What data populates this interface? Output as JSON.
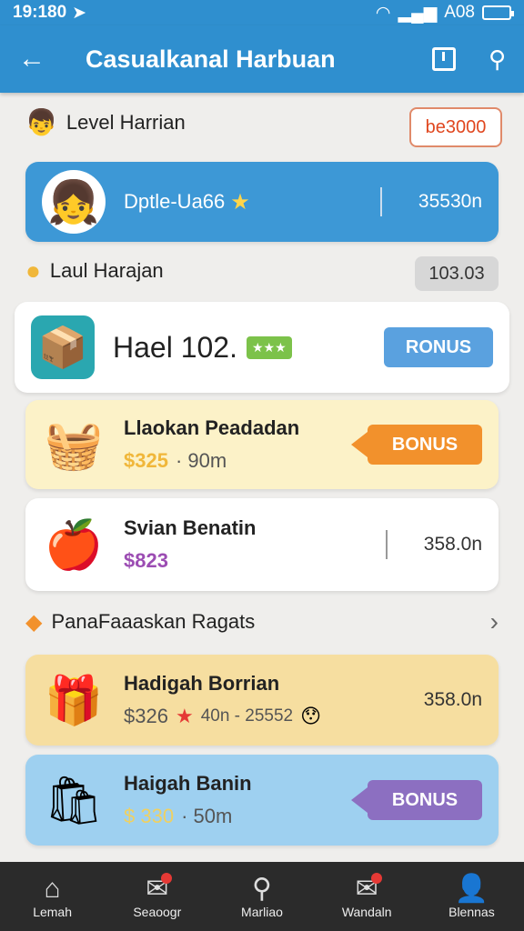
{
  "status": {
    "time": "19:180",
    "network": "A08"
  },
  "appbar": {
    "title": "Casualkanal Harbuan"
  },
  "section1": {
    "title": "Level Harrian",
    "badge": "be3000"
  },
  "profile": {
    "name": "Dptle-Ua66",
    "value": "35530n"
  },
  "section2": {
    "title": "Laul Harajan",
    "badge": "103.03"
  },
  "card1": {
    "name": "Hael 102.",
    "tag": "★★★",
    "button": "RONUS"
  },
  "card2": {
    "name": "Llaokan Peadadan",
    "price": "$325",
    "sub": "· 90m",
    "button": "BONUS"
  },
  "card3": {
    "name": "Svian Benatin",
    "price": "$823",
    "value": "358.0n"
  },
  "section3": {
    "title": "PanaFaaaskan Ragats"
  },
  "card4": {
    "name": "Hadigah Borrian",
    "price": "$326",
    "sub": "40n - 25552",
    "value": "358.0n"
  },
  "card5": {
    "name": "Haigah Banin",
    "price": "$ 330",
    "sub": "· 50m",
    "button": "BONUS"
  },
  "nav": [
    {
      "label": "Lemah",
      "icon": "home-icon"
    },
    {
      "label": "Seaoogr",
      "icon": "gift-icon"
    },
    {
      "label": "Marliao",
      "icon": "search-icon"
    },
    {
      "label": "Wandaln",
      "icon": "inbox-icon"
    },
    {
      "label": "Blennas",
      "icon": "profile-icon"
    }
  ],
  "colors": {
    "primary": "#2f8fcf",
    "orange": "#f2912c",
    "purple": "#8c6fc1",
    "gold": "#f0b73a",
    "violet": "#9c4db3"
  }
}
